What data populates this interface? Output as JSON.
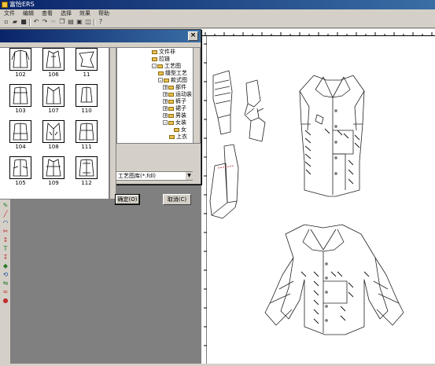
{
  "window": {
    "title": "富怡ERS"
  },
  "menu": [
    "文件",
    "编辑",
    "查看",
    "选择",
    "效果",
    "帮助"
  ],
  "dialog": {
    "thumbnails": [
      {
        "label": "102"
      },
      {
        "label": "106"
      },
      {
        "label": "11"
      },
      {
        "label": "103"
      },
      {
        "label": "107"
      },
      {
        "label": "110"
      },
      {
        "label": "104"
      },
      {
        "label": "108"
      },
      {
        "label": "111"
      },
      {
        "label": "105"
      },
      {
        "label": "109"
      },
      {
        "label": "112"
      }
    ],
    "tree": [
      {
        "label": "文件非",
        "expander": ""
      },
      {
        "label": "拉链",
        "expander": ""
      },
      {
        "label": "工艺图",
        "expander": "-"
      },
      {
        "label": "缝型工艺",
        "expander": ""
      },
      {
        "label": "款式图",
        "expander": "-"
      },
      {
        "label": "部件",
        "expander": "+"
      },
      {
        "label": "运动装",
        "expander": "+"
      },
      {
        "label": "裤子",
        "expander": "+"
      },
      {
        "label": "裙子",
        "expander": "+"
      },
      {
        "label": "男装",
        "expander": "+"
      },
      {
        "label": "女装",
        "expander": "-"
      },
      {
        "label": "女",
        "expander": ""
      },
      {
        "label": "上衣",
        "expander": ""
      }
    ],
    "file_type": "工艺图库(*.fdl)",
    "ok_label": "确定(O)",
    "cancel_label": "取消(C)"
  }
}
